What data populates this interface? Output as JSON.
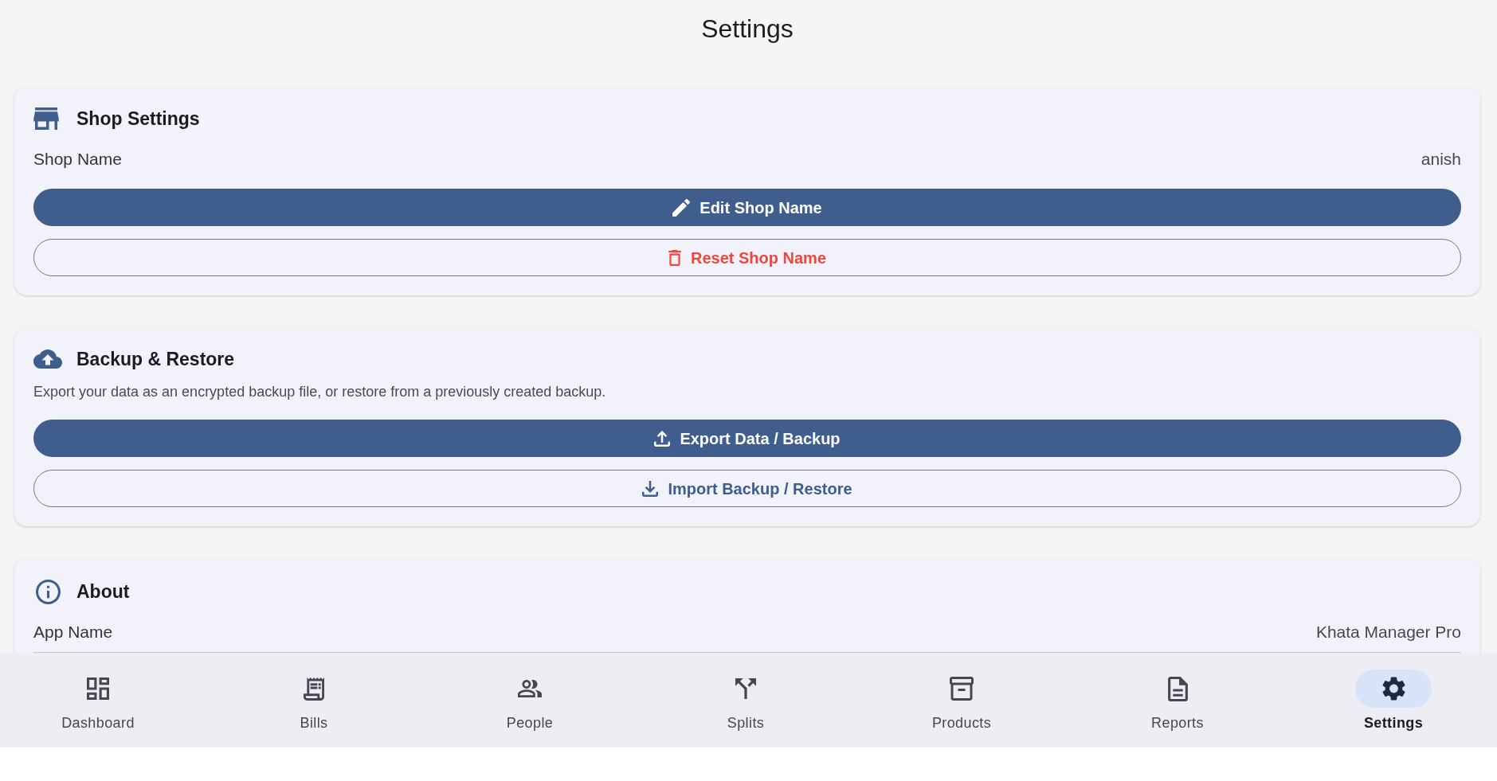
{
  "page": {
    "title": "Settings"
  },
  "sections": [
    {
      "kind": "form",
      "title": "Shop Settings",
      "rows": [
        {
          "label": "Shop Name",
          "value": "anish"
        }
      ],
      "buttons": [
        {
          "kind": "filled",
          "label": "Edit Shop Name"
        },
        {
          "kind": "danger",
          "label": "Reset Shop Name"
        }
      ]
    },
    {
      "kind": "actions",
      "title": "Backup & Restore",
      "description": "Export your data as an encrypted backup file, or restore from a previously created backup.",
      "buttons": [
        {
          "kind": "filled",
          "label": "Export Data / Backup"
        },
        {
          "kind": "outlined",
          "label": "Import Backup / Restore"
        }
      ]
    },
    {
      "kind": "info",
      "title": "About",
      "rows": [
        {
          "label": "App Name",
          "value": "Khata Manager Pro"
        }
      ]
    }
  ],
  "nav": [
    {
      "label": "Dashboard",
      "selected": false
    },
    {
      "label": "Bills",
      "selected": false
    },
    {
      "label": "People",
      "selected": false
    },
    {
      "label": "Splits",
      "selected": false
    },
    {
      "label": "Products",
      "selected": false
    },
    {
      "label": "Reports",
      "selected": false
    },
    {
      "label": "Settings",
      "selected": true
    }
  ]
}
